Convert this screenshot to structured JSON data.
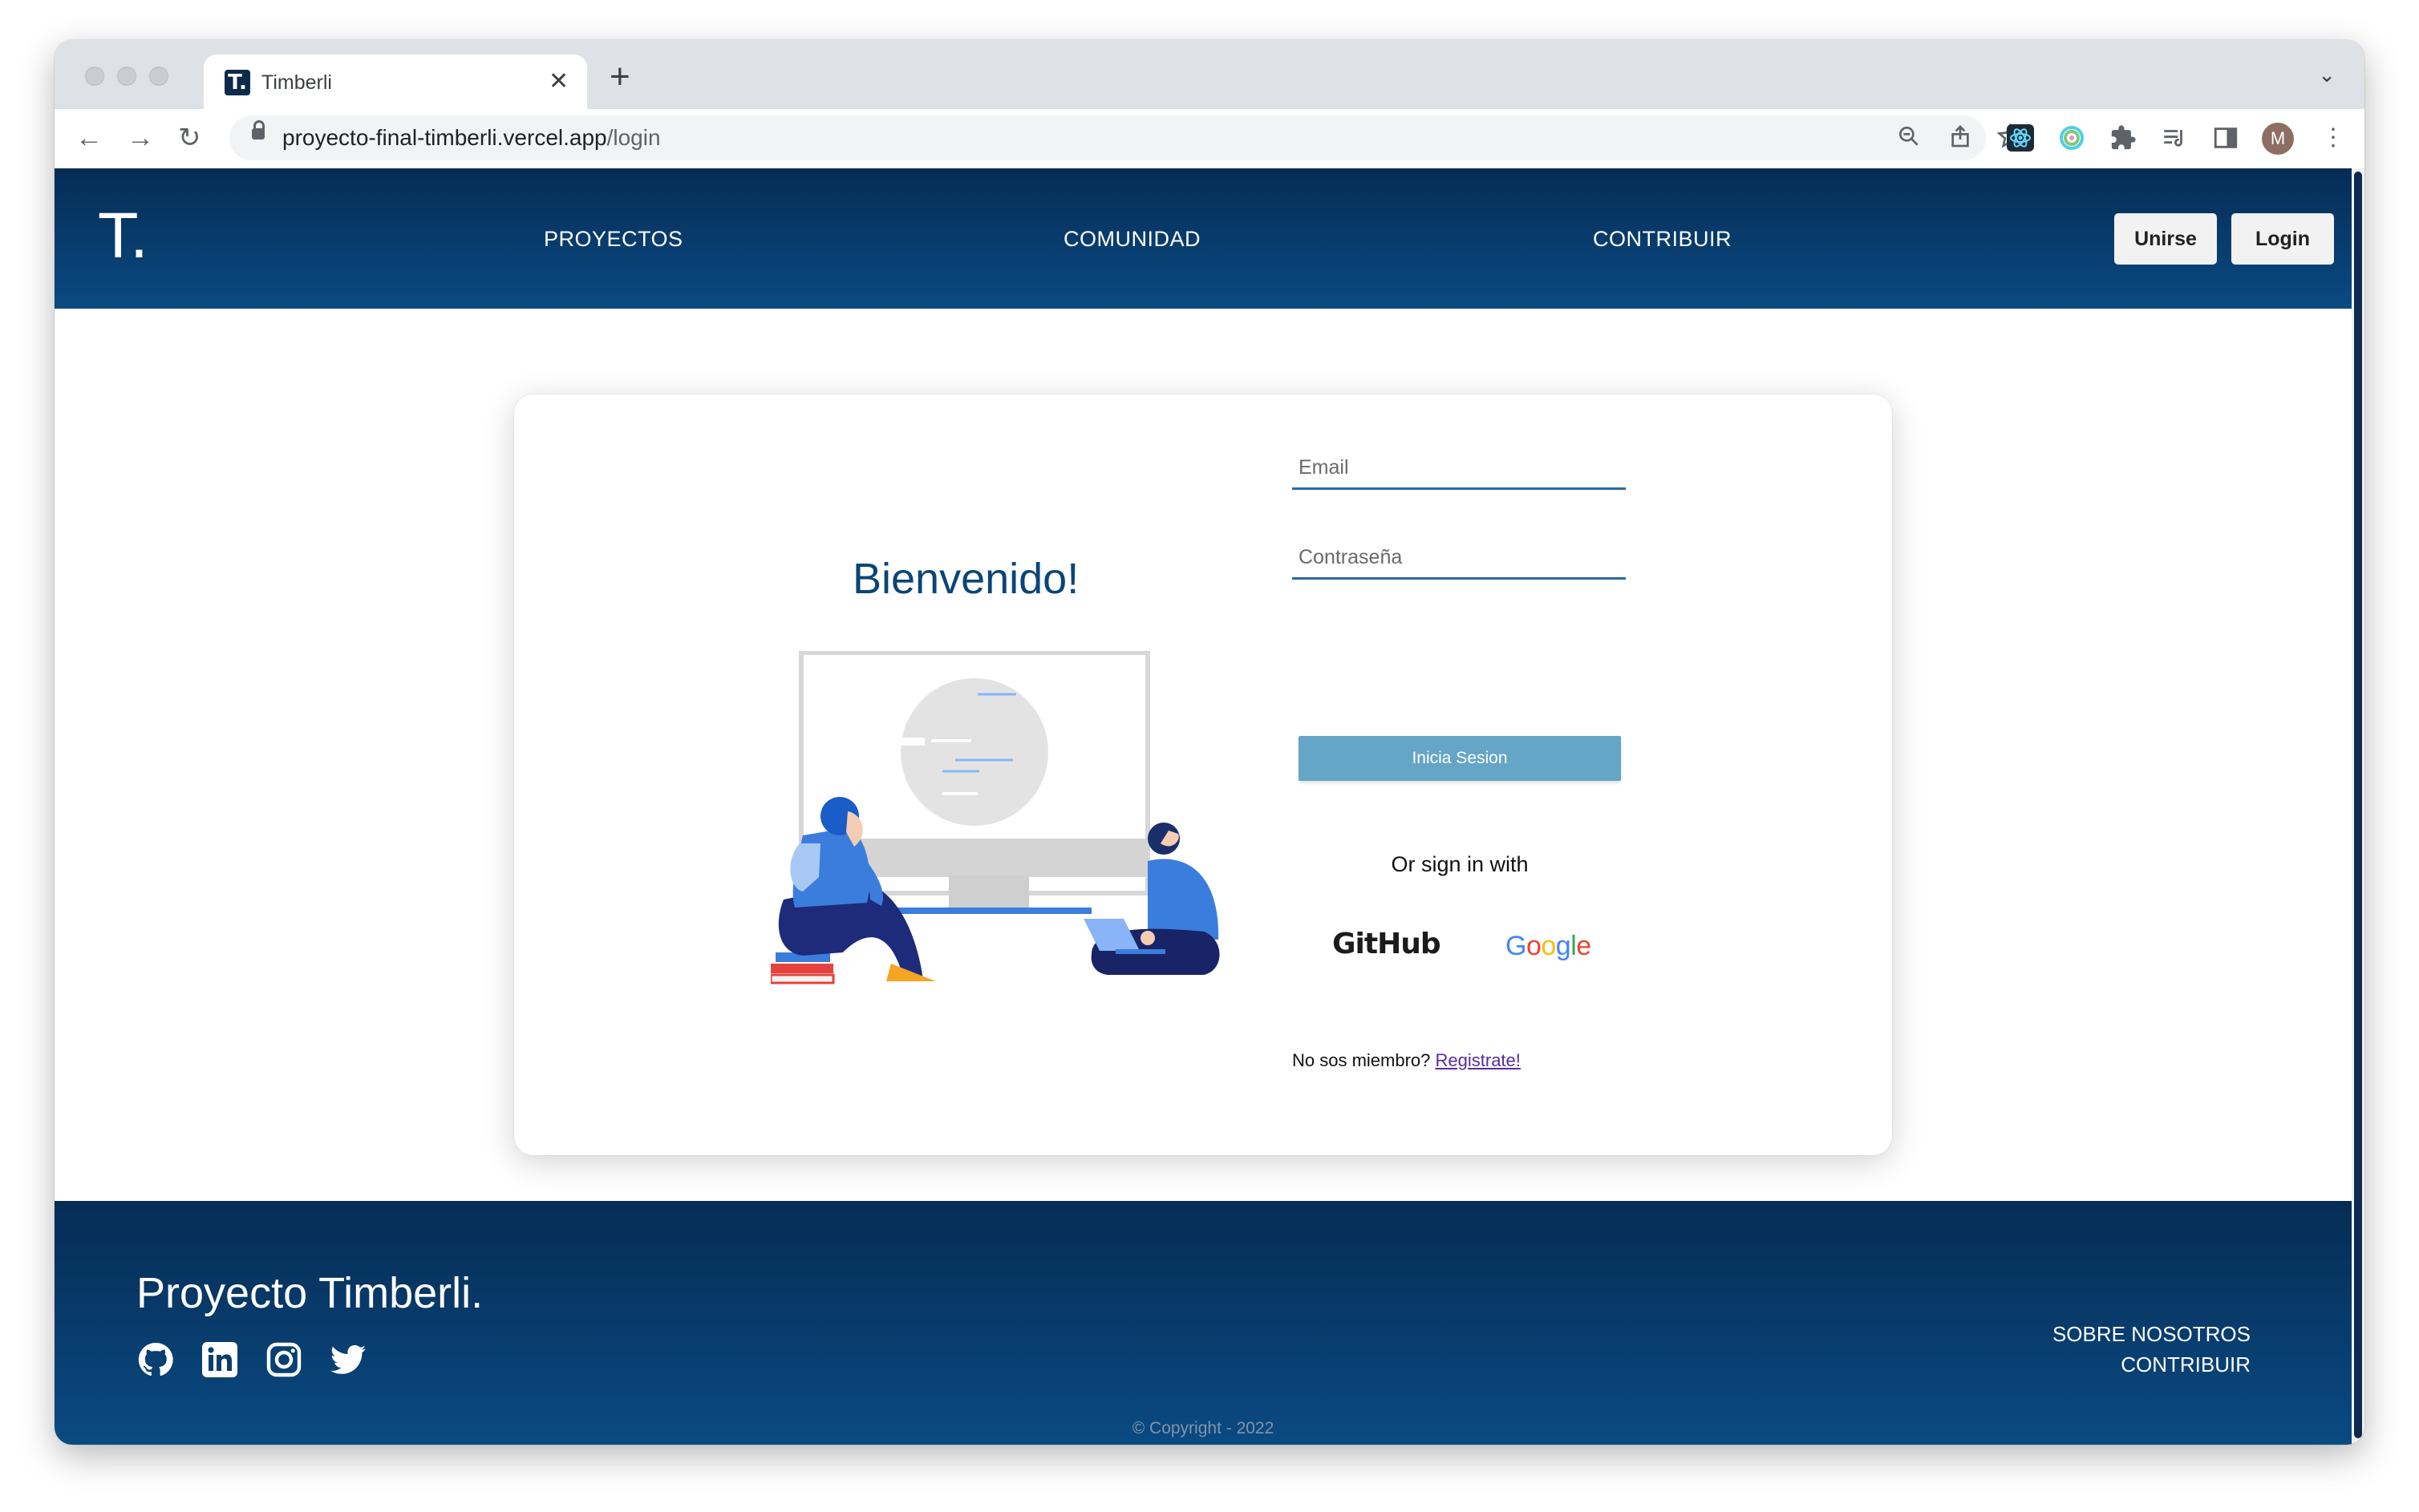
{
  "browser": {
    "tab_title": "Timberli",
    "tab_favicon": "T.",
    "new_tab": "+",
    "url_host": "proyecto-final-timberli.vercel.app",
    "url_path": "/login",
    "profile_initial": "M"
  },
  "site": {
    "logo": "T.",
    "nav": [
      "PROYECTOS",
      "COMUNIDAD",
      "CONTRIBUIR"
    ],
    "join_label": "Unirse",
    "login_label": "Login",
    "colors": {
      "header_top": "#062c55",
      "header_bottom": "#0a4a82",
      "button_primary": "#65a5c5"
    }
  },
  "login": {
    "welcome": "Bienvenido!",
    "email_placeholder": "Email",
    "password_placeholder": "Contraseña",
    "submit_label": "Inicia Sesion",
    "or_sign_in": "Or sign in with",
    "github_label": "GitHub",
    "google_label": "Google",
    "member_question": "No sos miembro?",
    "register_link": "Registrate!"
  },
  "footer": {
    "title": "Proyecto Timberli.",
    "social": [
      "github-icon",
      "linkedin-icon",
      "instagram-icon",
      "twitter-icon"
    ],
    "links": [
      "SOBRE NOSOTROS",
      "CONTRIBUIR"
    ],
    "copyright": "© Copyright - 2022"
  }
}
